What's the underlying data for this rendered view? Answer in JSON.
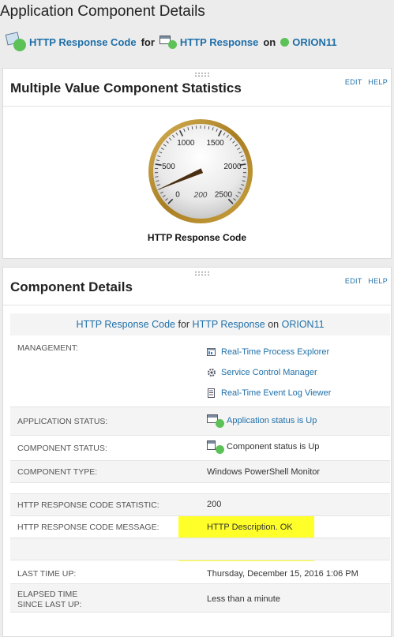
{
  "page": {
    "title": "Application Component Details"
  },
  "breadcrumb": {
    "component": "HTTP Response Code",
    "sep1": "for",
    "application": "HTTP Response",
    "sep2": "on",
    "node": "ORION11"
  },
  "gauge_panel": {
    "title": "Multiple Value Component Statistics",
    "edit": "EDIT",
    "help": "HELP",
    "gauge": {
      "ticks": [
        "0",
        "500",
        "1000",
        "1500",
        "2000",
        "2500"
      ],
      "min": 0,
      "max": 2500,
      "value": 200,
      "value_label": "200",
      "label": "HTTP Response Code"
    }
  },
  "details_panel": {
    "title": "Component Details",
    "edit": "EDIT",
    "help": "HELP",
    "header": {
      "component": "HTTP Response Code",
      "for": "for",
      "application": "HTTP Response",
      "on": "on",
      "node": "ORION11"
    },
    "management_label": "MANAGEMENT:",
    "management_links": [
      {
        "label": "Real-Time Process Explorer",
        "icon": "process-explorer-icon"
      },
      {
        "label": "Service Control Manager",
        "icon": "gear-icon"
      },
      {
        "label": "Real-Time Event Log Viewer",
        "icon": "event-log-icon"
      }
    ],
    "application_status_label": "APPLICATION STATUS:",
    "application_status_value": "Application status is Up",
    "component_status_label": "COMPONENT STATUS:",
    "component_status_value": "Component status is Up",
    "component_type_label": "COMPONENT TYPE:",
    "component_type_value": "Windows PowerShell Monitor",
    "statistic_label": "HTTP RESPONSE CODE STATISTIC:",
    "statistic_value": "200",
    "message_label": "HTTP RESPONSE CODE MESSAGE:",
    "message_value": "HTTP Description. OK",
    "last_time_up_label": "LAST TIME UP:",
    "last_time_up_value": "Thursday, December 15, 2016 1:06 PM",
    "elapsed_label_1": "ELAPSED TIME",
    "elapsed_label_2": "SINCE LAST UP:",
    "elapsed_value": "Less than a minute"
  },
  "colors": {
    "link": "#1e6fa8",
    "status_up": "#5cc157",
    "highlight": "#ffff2a",
    "gauge_rim": "#b48a2c"
  }
}
